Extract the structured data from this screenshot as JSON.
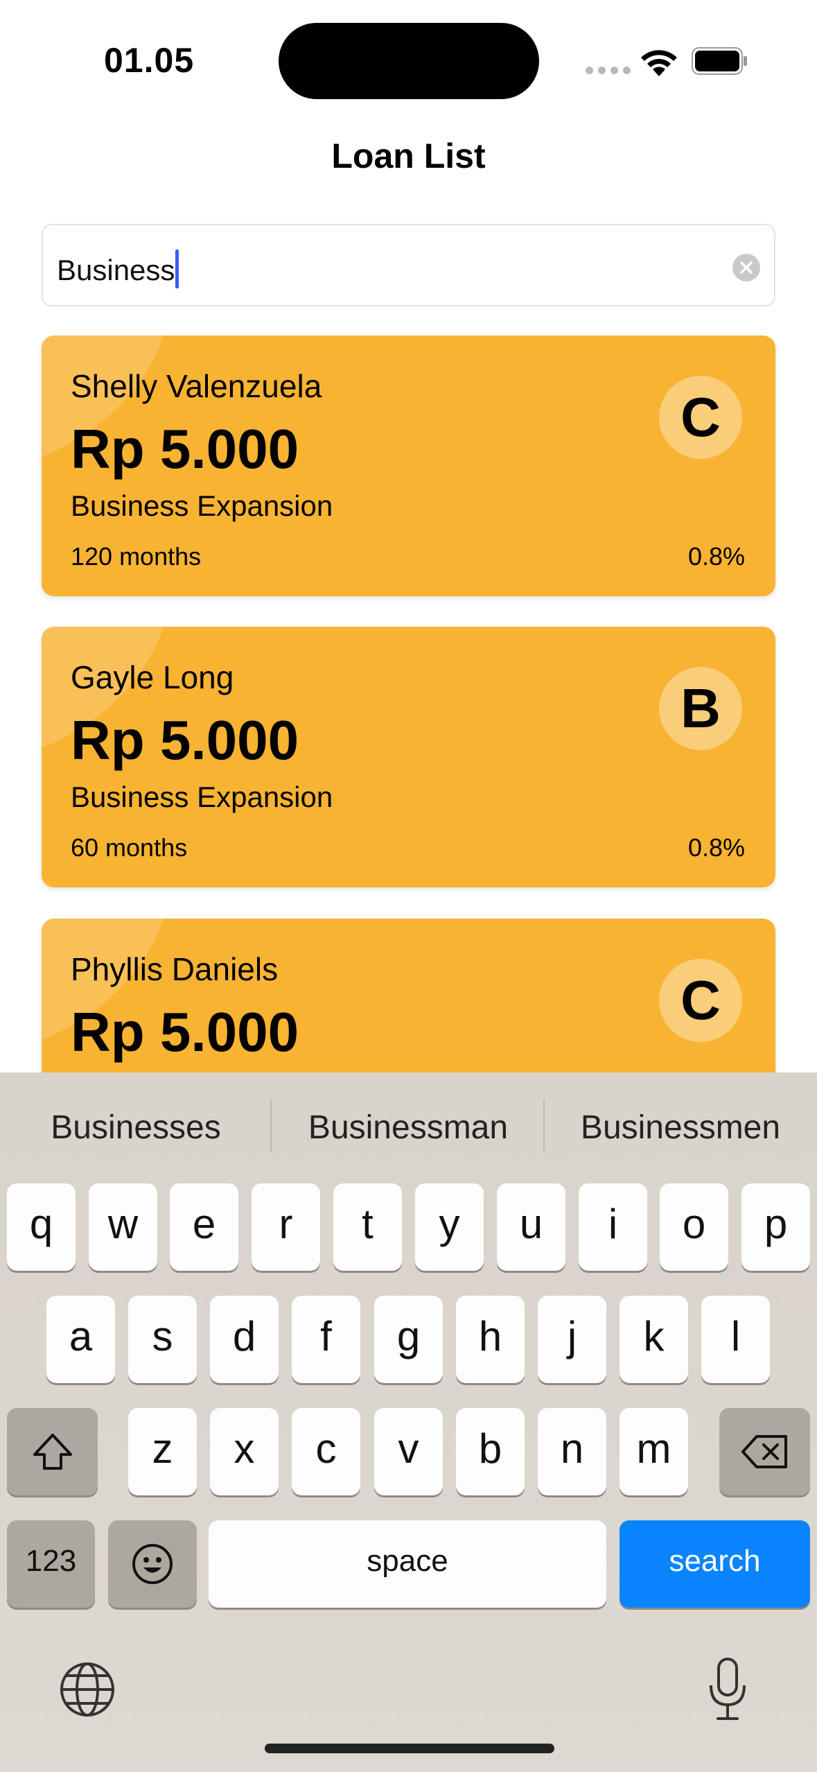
{
  "status": {
    "time": "01.05"
  },
  "header": {
    "title": "Loan List"
  },
  "search": {
    "value": "Business"
  },
  "loans": [
    {
      "name": "Shelly Valenzuela",
      "amount": "Rp 5.000",
      "purpose": "Business Expansion",
      "term": "120 months",
      "rate": "0.8%",
      "grade": "C"
    },
    {
      "name": "Gayle Long",
      "amount": "Rp 5.000",
      "purpose": "Business Expansion",
      "term": "60 months",
      "rate": "0.8%",
      "grade": "B"
    },
    {
      "name": "Phyllis Daniels",
      "amount": "Rp 5.000",
      "grade": "C"
    }
  ],
  "keyboard": {
    "suggestions": [
      "Businesses",
      "Businessman",
      "Businessmen"
    ],
    "row1": [
      "q",
      "w",
      "e",
      "r",
      "t",
      "y",
      "u",
      "i",
      "o",
      "p"
    ],
    "row2": [
      "a",
      "s",
      "d",
      "f",
      "g",
      "h",
      "j",
      "k",
      "l"
    ],
    "row3": [
      "z",
      "x",
      "c",
      "v",
      "b",
      "n",
      "m"
    ],
    "numbers_label": "123",
    "space_label": "space",
    "search_label": "search"
  },
  "colors": {
    "card": "#f8b332",
    "accent": "#0a84ff"
  }
}
